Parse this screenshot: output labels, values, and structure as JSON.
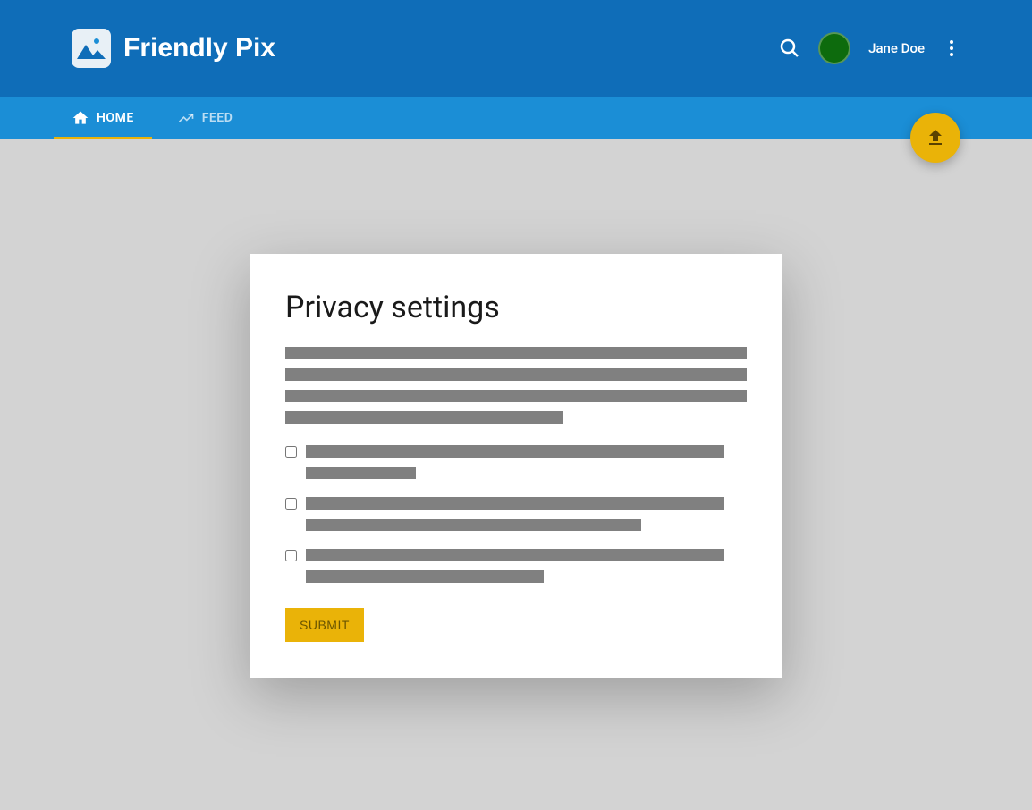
{
  "header": {
    "app_title": "Friendly Pix",
    "username": "Jane Doe"
  },
  "nav": {
    "tabs": [
      {
        "label": "HOME",
        "active": true
      },
      {
        "label": "FEED",
        "active": false
      }
    ]
  },
  "card": {
    "title": "Privacy settings",
    "submit_label": "SUBMIT"
  },
  "colors": {
    "header_bg": "#0f6db8",
    "nav_bg": "#1b8ed6",
    "accent": "#eab308",
    "avatar_bg": "#0d6b0d"
  }
}
